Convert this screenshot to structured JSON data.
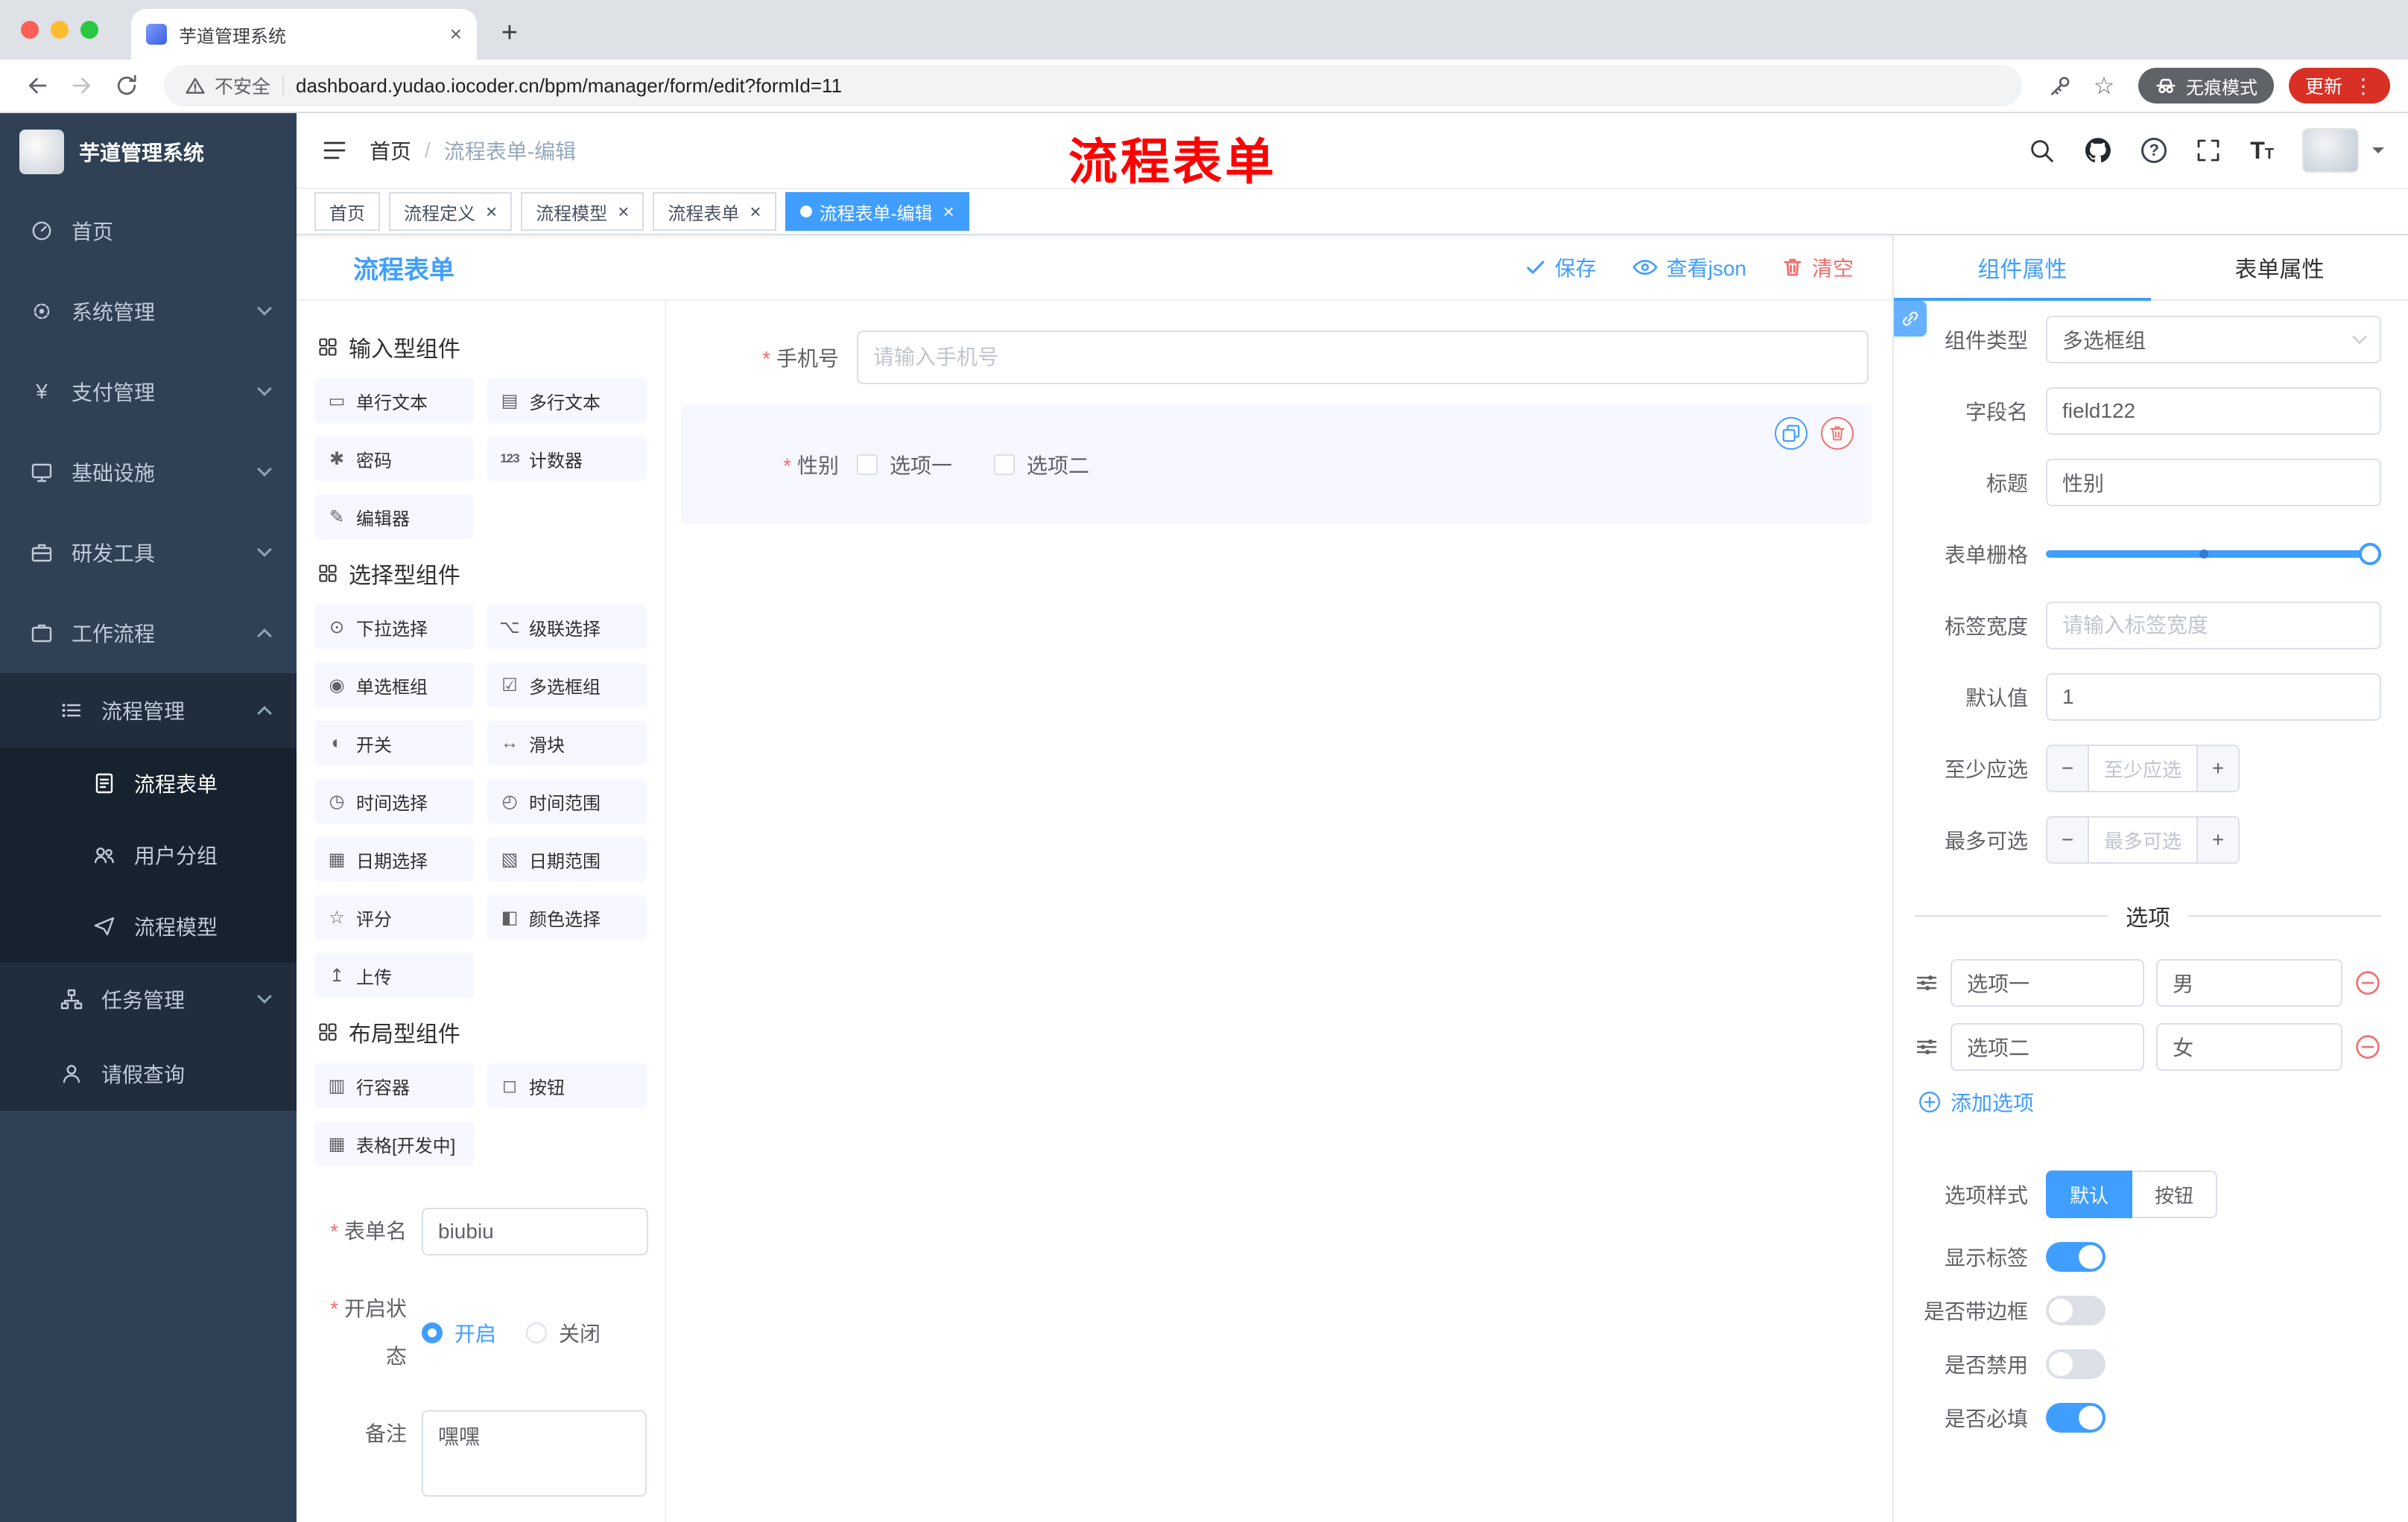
{
  "browser": {
    "tab_title": "芋道管理系统",
    "security": "不安全",
    "url": "dashboard.yudao.iocoder.cn/bpm/manager/form/edit?formId=11",
    "incognito": "无痕模式",
    "update": "更新"
  },
  "sidebar": {
    "title": "芋道管理系统",
    "items": [
      {
        "label": "首页"
      },
      {
        "label": "系统管理"
      },
      {
        "label": "支付管理"
      },
      {
        "label": "基础设施"
      },
      {
        "label": "研发工具"
      },
      {
        "label": "工作流程"
      },
      {
        "label": "流程管理"
      },
      {
        "label": "流程表单"
      },
      {
        "label": "用户分组"
      },
      {
        "label": "流程模型"
      },
      {
        "label": "任务管理"
      },
      {
        "label": "请假查询"
      }
    ]
  },
  "navbar": {
    "breadcrumb_home": "首页",
    "breadcrumb_sep": "/",
    "breadcrumb_current": "流程表单-编辑",
    "watermark": "流程表单"
  },
  "tags": [
    {
      "label": "首页"
    },
    {
      "label": "流程定义"
    },
    {
      "label": "流程模型"
    },
    {
      "label": "流程表单"
    },
    {
      "label": "流程表单-编辑"
    }
  ],
  "editor": {
    "title": "流程表单",
    "save": "保存",
    "view_json": "查看json",
    "clear": "清空"
  },
  "palette": {
    "g1_title": "输入型组件",
    "g1": [
      {
        "icon": "▭",
        "label": "单行文本"
      },
      {
        "icon": "▤",
        "label": "多行文本"
      },
      {
        "icon": "✱",
        "label": "密码"
      },
      {
        "icon": "123",
        "label": "计数器"
      },
      {
        "icon": "✎",
        "label": "编辑器"
      }
    ],
    "g2_title": "选择型组件",
    "g2": [
      {
        "icon": "⊙",
        "label": "下拉选择"
      },
      {
        "icon": "⌥",
        "label": "级联选择"
      },
      {
        "icon": "◉",
        "label": "单选框组"
      },
      {
        "icon": "☑",
        "label": "多选框组"
      },
      {
        "icon": "◐",
        "label": "开关"
      },
      {
        "icon": "↔",
        "label": "滑块"
      },
      {
        "icon": "◷",
        "label": "时间选择"
      },
      {
        "icon": "◴",
        "label": "时间范围"
      },
      {
        "icon": "▦",
        "label": "日期选择"
      },
      {
        "icon": "▧",
        "label": "日期范围"
      },
      {
        "icon": "☆",
        "label": "评分"
      },
      {
        "icon": "◧",
        "label": "颜色选择"
      },
      {
        "icon": "↥",
        "label": "上传"
      }
    ],
    "g3_title": "布局型组件",
    "g3": [
      {
        "icon": "▥",
        "label": "行容器"
      },
      {
        "icon": "◻",
        "label": "按钮"
      },
      {
        "icon": "▦",
        "label": "表格[开发中]"
      }
    ],
    "form": {
      "name_label": "表单名",
      "name_value": "biubiu",
      "status_label": "开启状态",
      "status_on": "开启",
      "status_off": "关闭",
      "remark_label": "备注",
      "remark_value": "嘿嘿"
    }
  },
  "canvas": {
    "phone_label": "手机号",
    "phone_placeholder": "请输入手机号",
    "gender_label": "性别",
    "gender_options": [
      "选项一",
      "选项二"
    ]
  },
  "props": {
    "tab_component": "组件属性",
    "tab_form": "表单属性",
    "type_label": "组件类型",
    "type_value": "多选框组",
    "field_label": "字段名",
    "field_value": "field122",
    "title_label": "标题",
    "title_value": "性别",
    "grid_label": "表单栅格",
    "width_label": "标签宽度",
    "width_placeholder": "请输入标签宽度",
    "default_label": "默认值",
    "default_value": "1",
    "min_label": "至少应选",
    "min_placeholder": "至少应选",
    "max_label": "最多可选",
    "max_placeholder": "最多可选",
    "options_title": "选项",
    "options": [
      {
        "label": "选项一",
        "value": "男"
      },
      {
        "label": "选项二",
        "value": "女"
      }
    ],
    "add_option": "添加选项",
    "style_label": "选项样式",
    "style_default": "默认",
    "style_button": "按钮",
    "toggles": [
      {
        "label": "显示标签",
        "on": true
      },
      {
        "label": "是否带边框",
        "on": false
      },
      {
        "label": "是否禁用",
        "on": false
      },
      {
        "label": "是否必填",
        "on": true
      }
    ]
  }
}
